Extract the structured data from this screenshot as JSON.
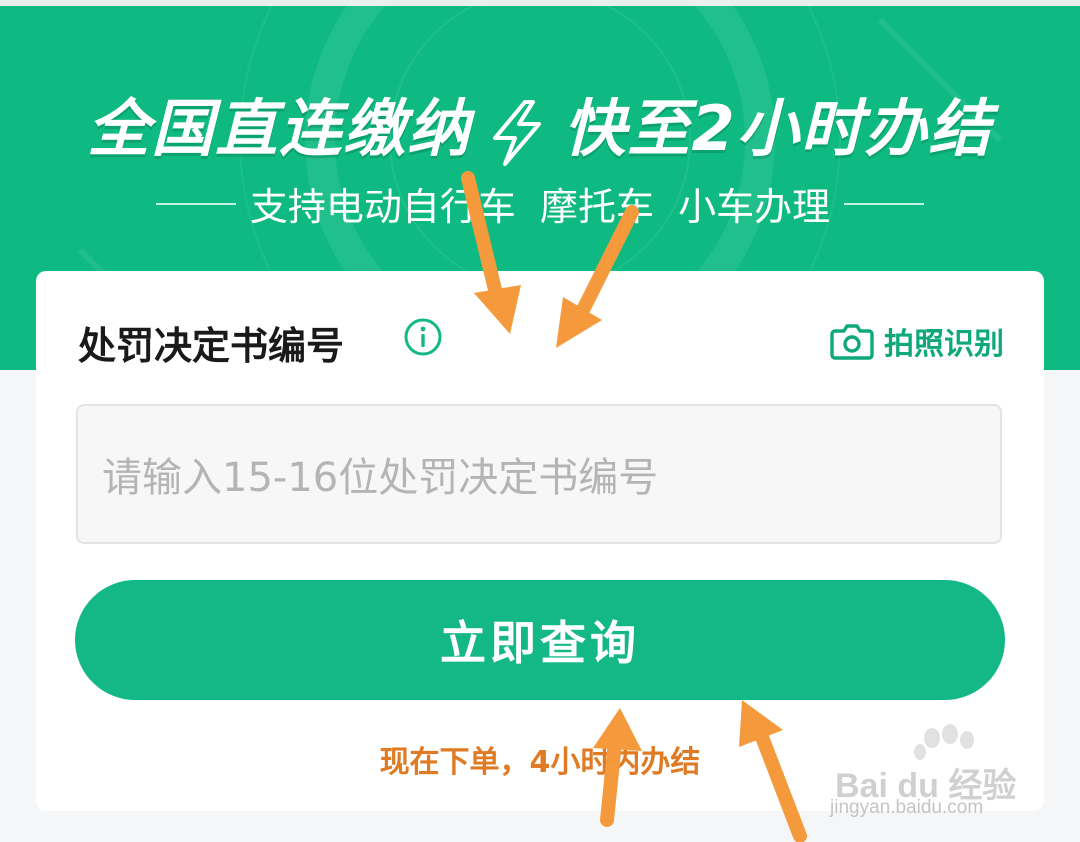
{
  "banner": {
    "headline_left": "全国直连缴纳",
    "headline_right": "快至2小时办结",
    "subline": "支持电动自行车  摩托车  小车办理",
    "icon": "lightning-bolt-icon"
  },
  "form": {
    "title": "处罚决定书编号",
    "info_icon": "info-icon",
    "photo_label": "拍照识别",
    "photo_icon": "camera-icon",
    "input_placeholder": "请输入15-16位处罚决定书编号",
    "input_value": "",
    "submit_label": "立即查询",
    "note": "现在下单，4小时内办结"
  },
  "watermark": {
    "brand": "Bai du 经验",
    "url": "jingyan.baidu.com"
  },
  "colors": {
    "brand_green": "#0fba82",
    "button_green": "#14b886",
    "note_orange": "#e07a23",
    "arrow_orange": "#f59a3c"
  }
}
